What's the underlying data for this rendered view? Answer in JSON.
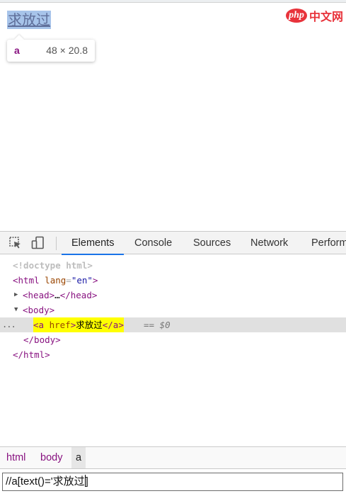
{
  "page": {
    "link_text": "求放过",
    "tooltip": {
      "tag": "a",
      "size": "48 × 20.8"
    },
    "watermark": {
      "logo": "php",
      "site": "中文网"
    }
  },
  "devtools": {
    "toolbar": {
      "icons": [
        "inspect-element-icon",
        "device-toolbar-icon"
      ],
      "tabs": [
        "Elements",
        "Console",
        "Sources",
        "Network",
        "Perform"
      ],
      "active_tab": "Elements"
    },
    "dom": {
      "doctype": "<!doctype html>",
      "html_open": {
        "tag": "html",
        "attr": "lang",
        "value": "\"en\""
      },
      "head": {
        "open": "head",
        "ellipsis": "…",
        "close": "/head"
      },
      "body_open": "body",
      "selected": {
        "tag": "a",
        "attr": "href",
        "text": "求放过",
        "close": "/a",
        "eq": "== $0",
        "dots": "..."
      },
      "body_close": "/body",
      "html_close": "/html"
    },
    "breadcrumbs": [
      "html",
      "body",
      "a"
    ],
    "search": {
      "value": "//a[text()='求放过",
      "after_caret": "]"
    }
  }
}
